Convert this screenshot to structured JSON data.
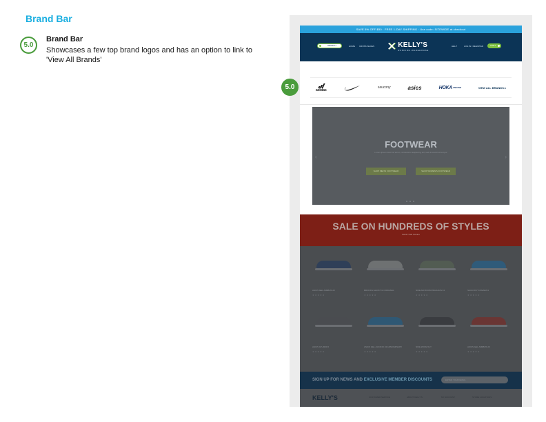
{
  "page": {
    "section_title": "Brand Bar"
  },
  "annotation": {
    "badge": "5.0",
    "title": "Brand Bar",
    "description": "Showcases a few top brand logos and has an option to link to 'View All Brands'"
  },
  "mockup": {
    "badge": "5.0",
    "promo_text": "SAVE 5% OFF $50  ·  FREE 1-DAY SHIPPING  ·  Use code: SITEWIDE at checkout",
    "header": {
      "search_label": "SEARCH",
      "nav": [
        "HOME",
        "CROSS SHOES"
      ],
      "logo_name": "KELLY'S",
      "logo_sub": "RUNNING WAREHOUSE",
      "right_links": [
        "HELP",
        "LOG IN / REGISTER"
      ],
      "cart_label": "CART"
    },
    "brands": {
      "items": [
        "adidas",
        "nike",
        "saucony",
        "asics",
        "HOKA"
      ],
      "hoka_sub": "ONE ONE",
      "view_all": "VIEW ALL BRANDS ▸"
    },
    "hero": {
      "title": "FOOTWEAR",
      "subtitle": "Lorem ipsum dolor sit amet, consectetur adipiscing elit, sed do eiusmod tempor",
      "buttons": [
        "SHOP MEN'S FOOTWEAR",
        "SHOP WOMEN'S FOOTWEAR"
      ]
    },
    "sale": {
      "title": "SALE ON HUNDREDS OF STYLES",
      "button": "SHOP THE SALE ▸"
    },
    "products": [
      {
        "name": "ASICS GEL-NIMBUS 20",
        "color": "#2f3f58"
      },
      {
        "name": "BROOKS GHOST 10 ORIGINAL",
        "color": "#6e7172"
      },
      {
        "name": "NIKE AIR ZOOM PEGASUS 34",
        "color": "#525c52"
      },
      {
        "name": "SAUCONY KINVARA 9",
        "color": "#2f5b7a"
      },
      {
        "name": "ASICS GT-2000 6",
        "color": "#4a4c50"
      },
      {
        "name": "ASICS GEL-KAYANO 24 ANNIVERSARY",
        "color": "#2f5874"
      },
      {
        "name": "NIKE ZOOM FLY",
        "color": "#3a3c40"
      },
      {
        "name": "ASICS GEL-NIMBUS 20",
        "color": "#6a3634"
      }
    ],
    "product_stars": "★★★★★",
    "signup": {
      "lead": "SIGN UP FOR NEWS AND",
      "highlight": "EXCLUSIVE MEMBER DISCOUNTS",
      "placeholder": "ENTER YOUR EMAIL"
    },
    "footer": {
      "logo": "KELLY'S",
      "columns": [
        "CUSTOMER SERVICE",
        "ABOUT KELLY'S",
        "MY ACCOUNT",
        "STORE LOCATIONS"
      ]
    }
  }
}
